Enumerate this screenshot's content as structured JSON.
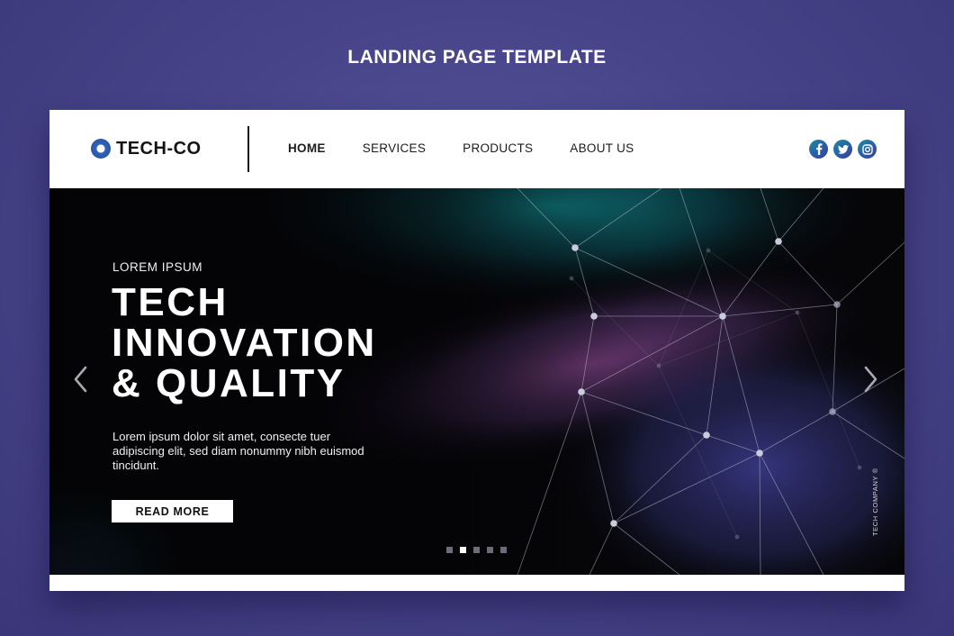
{
  "page_title": "LANDING PAGE TEMPLATE",
  "navbar": {
    "logo_text": "TECH-CO",
    "links": [
      {
        "label": "HOME",
        "active": true
      },
      {
        "label": "SERVICES",
        "active": false
      },
      {
        "label": "PRODUCTS",
        "active": false
      },
      {
        "label": "ABOUT US",
        "active": false
      }
    ],
    "socials": [
      "facebook-icon",
      "twitter-icon",
      "instagram-icon"
    ]
  },
  "hero": {
    "eyebrow": "LOREM IPSUM",
    "headline": "TECH\nINNOVATION\n& QUALITY",
    "body": "Lorem ipsum dolor sit amet, consecte tuer adipiscing elit, sed diam nonummy nibh euismod tincidunt.",
    "cta_label": "READ MORE",
    "vertical_brand": "TECH COMPANY ®",
    "slides": {
      "count": 5,
      "active_index": 1
    }
  },
  "colors": {
    "background": "#47448a",
    "accent_teal": "#1f8a99",
    "accent_blue": "#2a5fa6",
    "hero_bg": "#050507"
  }
}
